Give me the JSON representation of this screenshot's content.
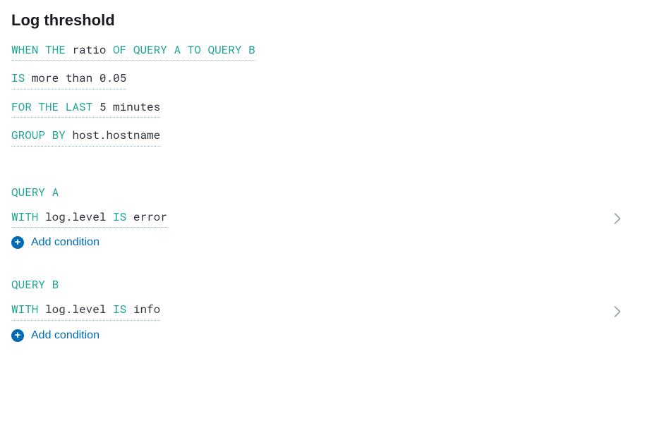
{
  "title": "Log threshold",
  "threshold": {
    "when_the": "WHEN THE",
    "ratio": "ratio",
    "of_query_a_to_query_b": "OF QUERY A TO QUERY B",
    "is": "IS",
    "comparator": "more than",
    "value": "0.05",
    "for_the_last": "FOR THE LAST",
    "duration": "5 minutes",
    "group_by": "GROUP BY",
    "group_field": "host.hostname"
  },
  "queryA": {
    "label": "QUERY A",
    "with": "WITH",
    "field": "log.level",
    "is": "IS",
    "value": "error",
    "add_condition": "Add condition"
  },
  "queryB": {
    "label": "QUERY B",
    "with": "WITH",
    "field": "log.level",
    "is": "IS",
    "value": "info",
    "add_condition": "Add condition"
  }
}
